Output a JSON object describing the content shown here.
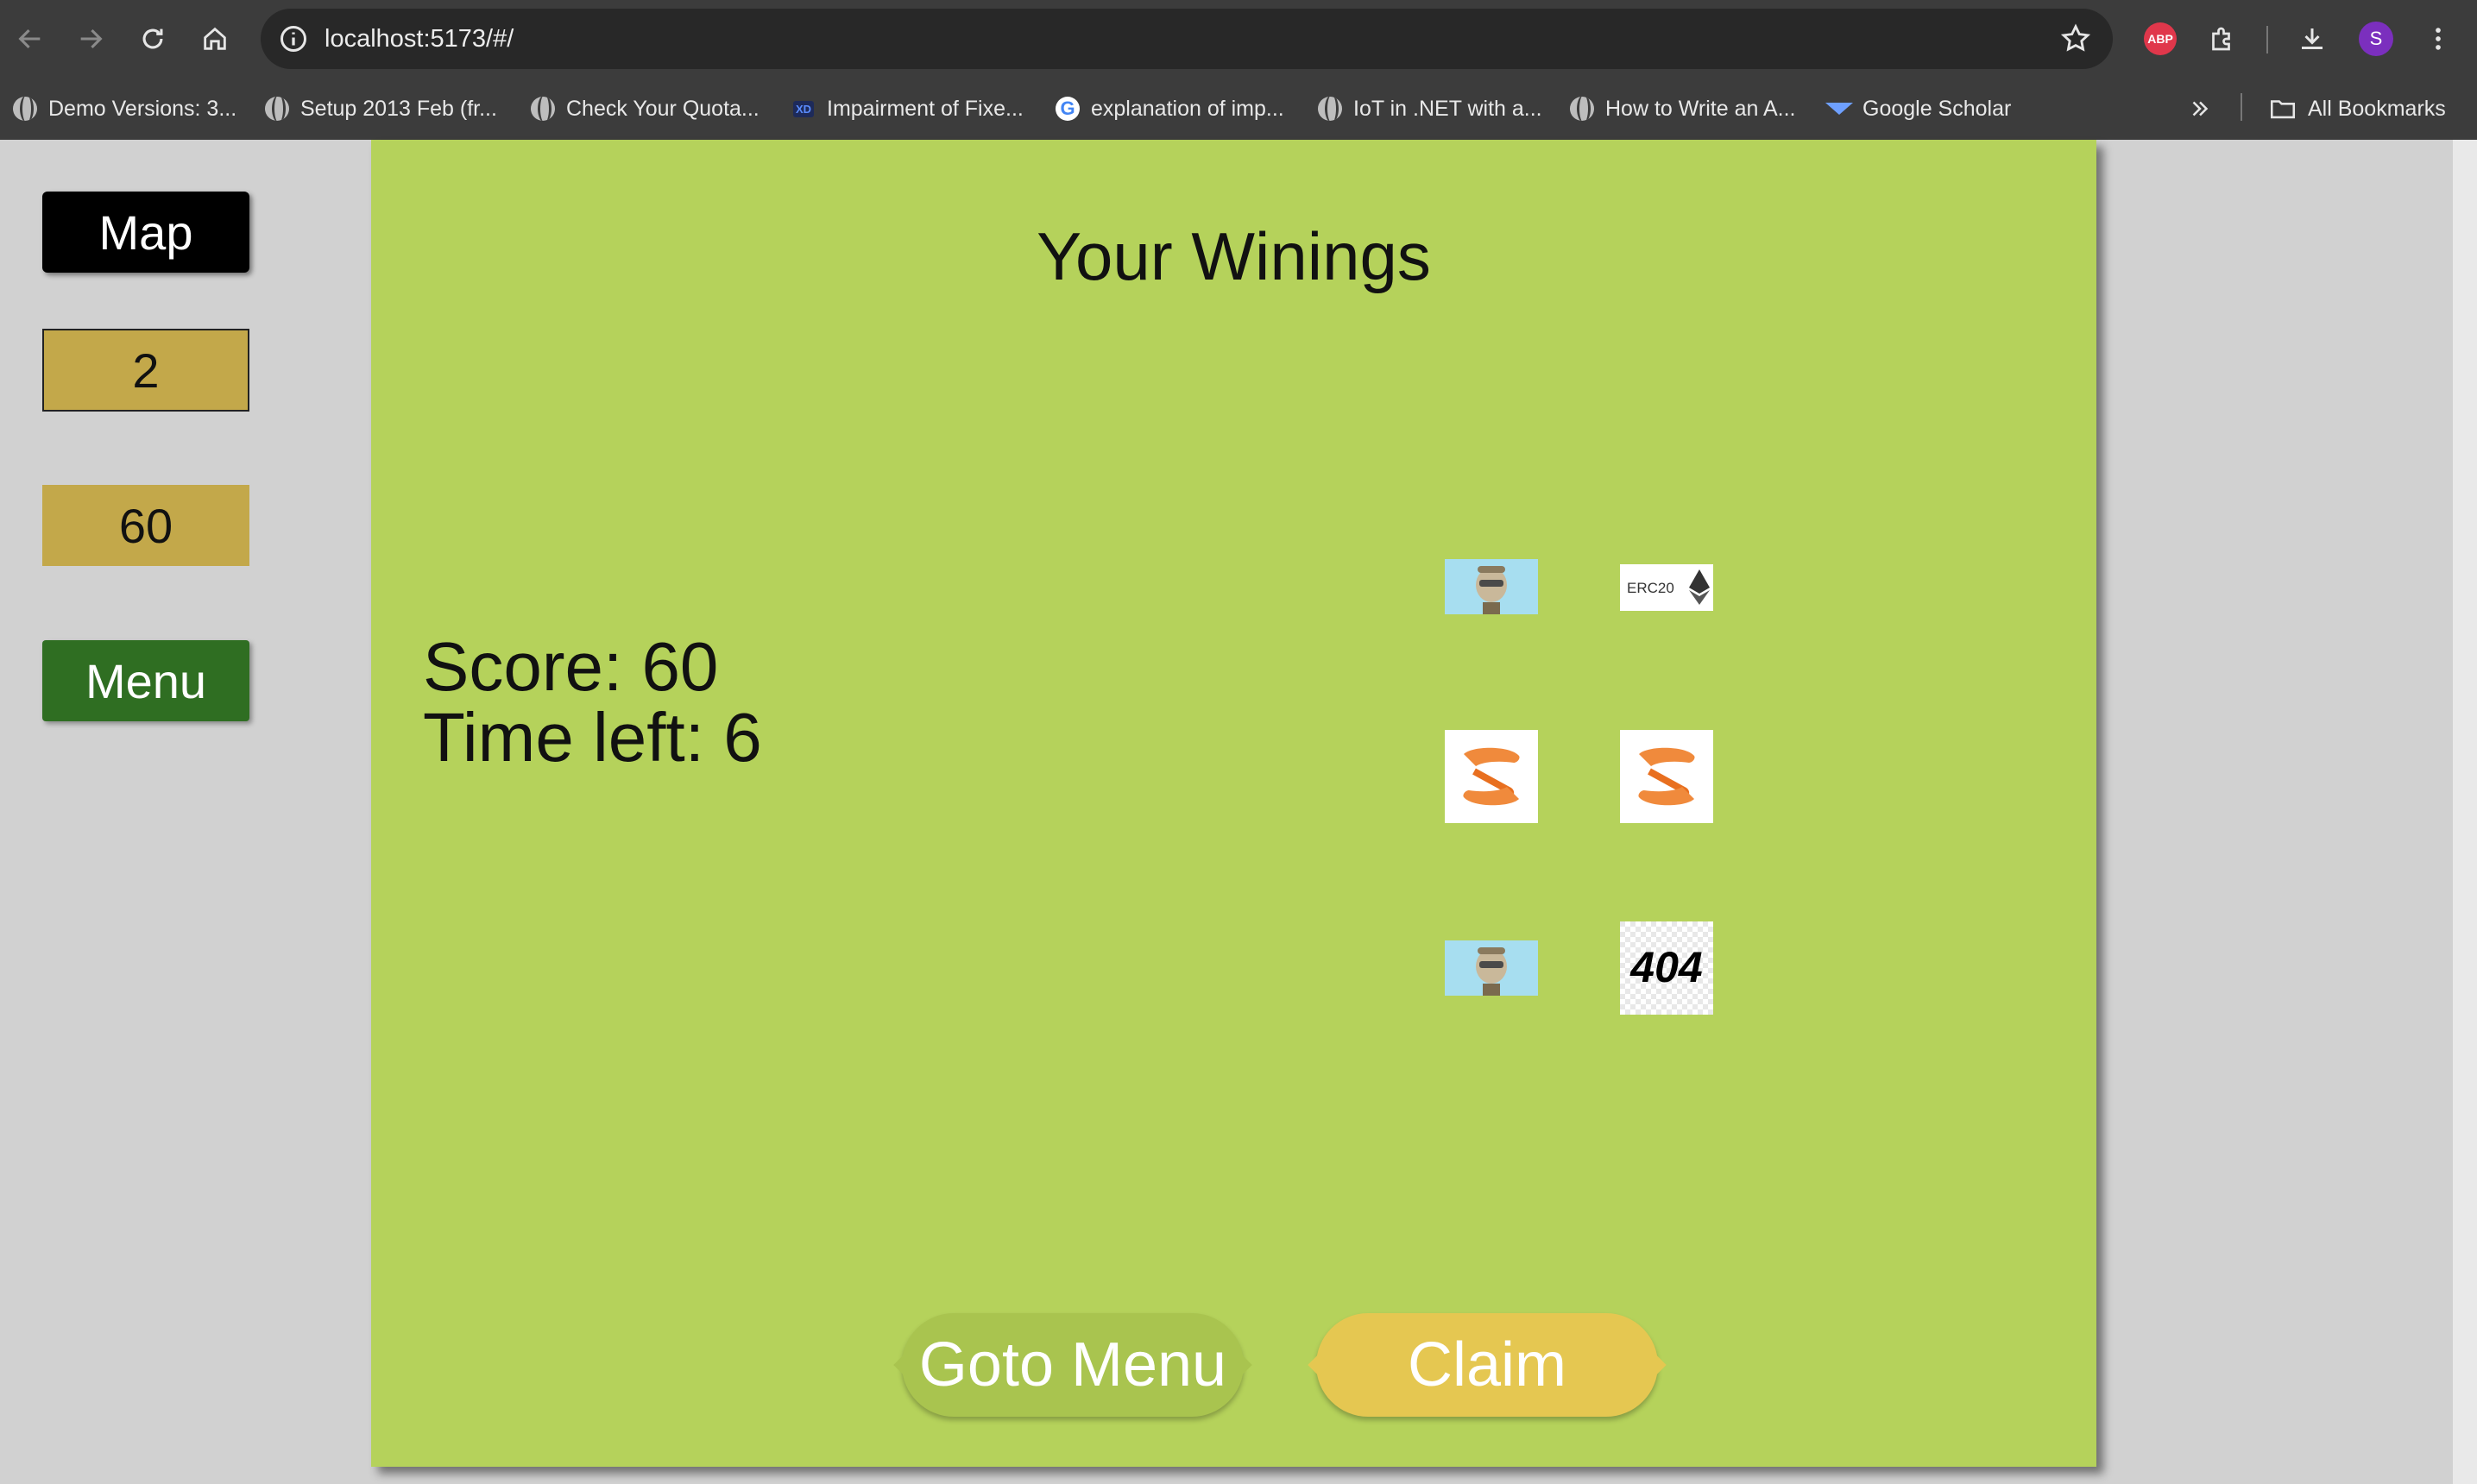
{
  "browser": {
    "url": "localhost:5173/#/",
    "bookmarks": [
      {
        "label": "Demo Versions: 3...",
        "icon": "globe-icon"
      },
      {
        "label": "Setup 2013 Feb (fr...",
        "icon": "globe-icon"
      },
      {
        "label": "Check Your Quota...",
        "icon": "globe-icon"
      },
      {
        "label": "Impairment of Fixe...",
        "icon": "xd-icon"
      },
      {
        "label": "explanation of imp...",
        "icon": "google-icon"
      },
      {
        "label": "IoT in .NET with a...",
        "icon": "globe-icon"
      },
      {
        "label": "How to Write an A...",
        "icon": "globe-icon"
      },
      {
        "label": "Google Scholar",
        "icon": "scholar-icon"
      }
    ],
    "all_bookmarks": "All Bookmarks",
    "avatar_letter": "S",
    "abp_label": "ABP"
  },
  "sidebar": {
    "map_label": "Map",
    "level_value": "2",
    "score_value": "60",
    "menu_label": "Menu"
  },
  "game": {
    "title": "Your Winings",
    "score_text": "Score: 60",
    "time_text": "Time left: 6",
    "rewards": [
      {
        "name": "ape-nft",
        "icon": "ape-nft-icon"
      },
      {
        "name": "erc20-token",
        "icon": "erc20-ethereum-icon",
        "label": "ERC20"
      },
      {
        "name": "swap-token",
        "icon": "orange-s-token-icon"
      },
      {
        "name": "swap-token",
        "icon": "orange-s-token-icon"
      },
      {
        "name": "ape-nft",
        "icon": "ape-nft-icon"
      },
      {
        "name": "404-token",
        "icon": "404-icon",
        "label": "404"
      }
    ],
    "goto_menu_label": "Goto Menu",
    "claim_label": "Claim"
  },
  "colors": {
    "panel": "#b5d25b",
    "gold": "#c3a84a",
    "menu_green": "#2f6e22",
    "claim": "#e5c751",
    "goto": "#a9c44f"
  }
}
